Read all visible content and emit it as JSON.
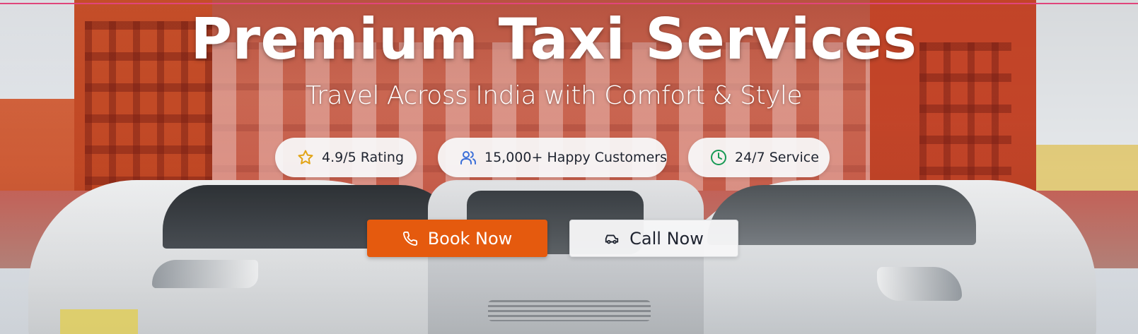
{
  "hero": {
    "title": "Premium Taxi Services",
    "subtitle": "Travel Across India with Comfort & Style"
  },
  "badges": [
    {
      "icon": "star-icon",
      "label": "4.9/5 Rating",
      "color": "#e2a415"
    },
    {
      "icon": "users-icon",
      "label": "15,000+ Happy Customers",
      "color": "#3b6fd8"
    },
    {
      "icon": "clock-icon",
      "label": "24/7 Service",
      "color": "#179a55"
    }
  ],
  "actions": {
    "book_label": "Book Now",
    "call_label": "Call Now"
  },
  "colors": {
    "accent": "#e55a0e",
    "top_border": "#e0457b"
  }
}
